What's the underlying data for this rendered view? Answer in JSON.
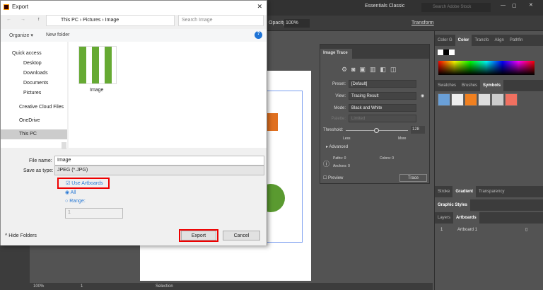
{
  "app": {
    "workspace": "Essentials Classic",
    "stock_search_placeholder": "Search Adobe Stock",
    "opacity_label": "Opacity:",
    "opacity_value": "100%",
    "transform_label": "Transform"
  },
  "status": {
    "zoom": "100%",
    "page": "1",
    "tool": "Selection"
  },
  "image_trace": {
    "title": "Image Trace",
    "preset_label": "Preset:",
    "preset": "[Default]",
    "view_label": "View:",
    "view": "Tracing Result",
    "mode_label": "Mode:",
    "mode": "Black and White",
    "palette_label": "Palette:",
    "palette": "Limited",
    "threshold_label": "Threshold:",
    "threshold": "128",
    "threshold_fraction": 0.5,
    "less": "Less",
    "more": "More",
    "advanced": "Advanced",
    "paths_label": "Paths:",
    "paths": "0",
    "colors_label": "Colors:",
    "colors": "0",
    "anchors_label": "Anchors:",
    "anchors": "0",
    "preview": "Preview",
    "trace": "Trace"
  },
  "right_panels": {
    "color_tabs": [
      "Color G",
      "Color",
      "Transfo",
      "Align",
      "Pathfin"
    ],
    "symbol_tabs": [
      "Swatches",
      "Brushes",
      "Symbols"
    ],
    "stroke_tabs": [
      "Stroke",
      "Gradient",
      "Transparency"
    ],
    "graphic_styles": "Graphic Styles",
    "layer_tabs": [
      "Layers",
      "Artboards"
    ],
    "artboard_row": {
      "num": "1",
      "name": "Artboard 1"
    }
  },
  "dialog": {
    "title": "Export",
    "breadcrumb": [
      "This PC",
      "Pictures",
      "Image"
    ],
    "search_placeholder": "Search Image",
    "organize": "Organize",
    "new_folder": "New folder",
    "nav": [
      {
        "label": "Quick access",
        "icon": "star-icon"
      },
      {
        "label": "Desktop",
        "icon": "desktop-icon"
      },
      {
        "label": "Downloads",
        "icon": "download-icon"
      },
      {
        "label": "Documents",
        "icon": "document-icon"
      },
      {
        "label": "Pictures",
        "icon": "pictures-icon"
      },
      {
        "label": "Creative Cloud Files",
        "icon": "creative-cloud-icon"
      },
      {
        "label": "OneDrive",
        "icon": "cloud-icon"
      },
      {
        "label": "This PC",
        "icon": "computer-icon"
      }
    ],
    "file_item": "Image",
    "file_name_label": "File name:",
    "file_name": "Image",
    "save_type_label": "Save as type:",
    "save_type": "JPEG (*.JPG)",
    "use_artboards": "Use Artboards",
    "all": "All",
    "range": "Range:",
    "range_value": "1",
    "hide_folders": "Hide Folders",
    "export": "Export",
    "cancel": "Cancel"
  }
}
